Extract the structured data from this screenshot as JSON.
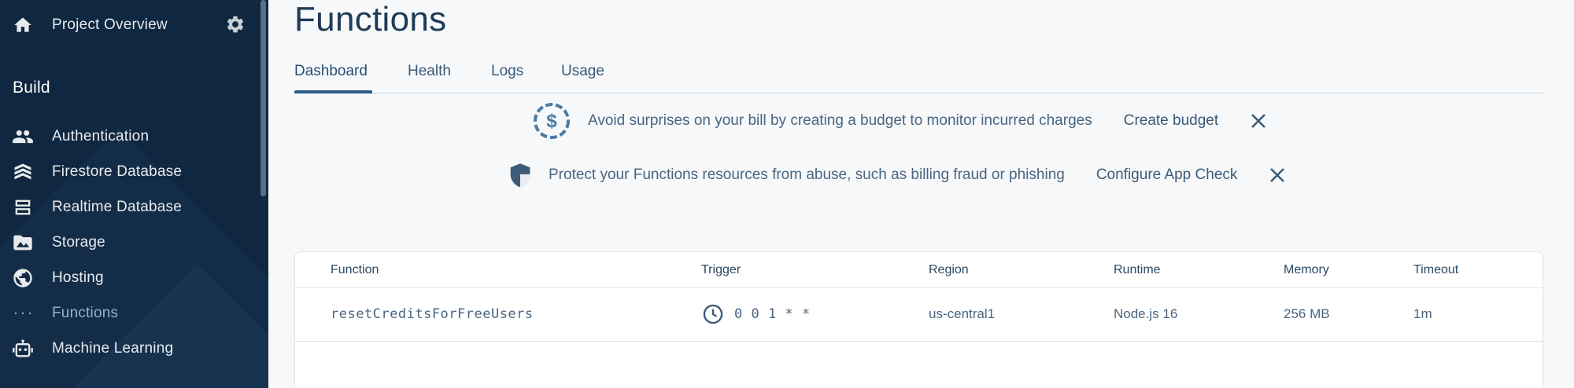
{
  "sidebar": {
    "project_overview": "Project Overview",
    "section_build": "Build",
    "items": [
      {
        "label": "Authentication",
        "icon": "people-icon"
      },
      {
        "label": "Firestore Database",
        "icon": "firestore-icon"
      },
      {
        "label": "Realtime Database",
        "icon": "database-icon"
      },
      {
        "label": "Storage",
        "icon": "image-icon"
      },
      {
        "label": "Hosting",
        "icon": "globe-icon"
      },
      {
        "label": "Functions",
        "icon": "functions-icon",
        "active": true
      },
      {
        "label": "Machine Learning",
        "icon": "robot-icon"
      }
    ]
  },
  "page": {
    "title": "Functions",
    "tabs": [
      "Dashboard",
      "Health",
      "Logs",
      "Usage"
    ],
    "active_tab": "Dashboard"
  },
  "banners": [
    {
      "message": "Avoid surprises on your bill by creating a budget to monitor incurred charges",
      "action": "Create budget",
      "icon": "dollar-budget-icon"
    },
    {
      "message": "Protect your Functions resources from abuse, such as billing fraud or phishing",
      "action": "Configure App Check",
      "icon": "shield-icon"
    }
  ],
  "table": {
    "columns": [
      "Function",
      "Trigger",
      "Region",
      "Runtime",
      "Memory",
      "Timeout"
    ],
    "rows": [
      {
        "function": "resetCreditsForFreeUsers",
        "trigger": "0 0 1 * *",
        "trigger_icon": "clock-icon",
        "region": "us-central1",
        "runtime": "Node.js 16",
        "memory": "256 MB",
        "timeout": "1m"
      }
    ]
  },
  "colors": {
    "sidebar_bg": "#0f2740",
    "main_bg": "#f6f8fa",
    "accent": "#2d5b86",
    "active_nav": "#8fb3d9"
  }
}
